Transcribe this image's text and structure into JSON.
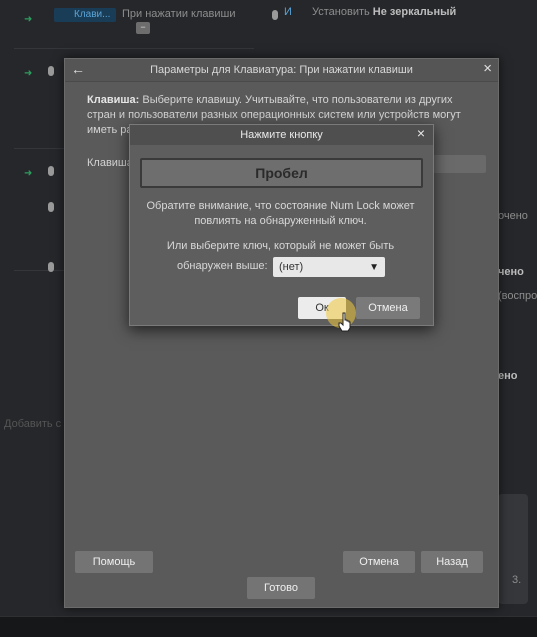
{
  "background": {
    "rows": [
      {
        "chip_label": "Клави...",
        "trigger": "При нажатии клавиши"
      },
      {
        "trigger": ""
      },
      {
        "trigger": ""
      }
    ],
    "top_right": {
      "prefix": "И",
      "action": "Установить",
      "value": "Не зеркальный",
      "sub": "..."
    },
    "right_fragments": [
      "очено",
      "чено",
      "(воспро",
      "ено"
    ],
    "footer_link": "Добавить с",
    "side_number": "3."
  },
  "dialog": {
    "title": "Параметры для Клавиатура: При нажатии клавиши",
    "back_icon": "arrow-left-icon",
    "close_icon": "close-icon",
    "desc_label": "Клавиша:",
    "desc_text": "Выберите клавишу. Учитывайте, что пользователи из других стран и пользователи разных операционных систем или устройств могут иметь разные",
    "key_label": "Клавиша",
    "buttons": {
      "help": "Помощь",
      "cancel": "Отмена",
      "back": "Назад",
      "done": "Готово"
    }
  },
  "modal": {
    "title": "Нажмите кнопку",
    "key_value": "Пробел",
    "note_numlock": "Обратите внимание, что состояние Num Lock может повлиять на обнаруженный ключ.",
    "note_choose_1": "Или выберите ключ, который не может быть",
    "note_choose_2": "обнаружен выше:",
    "select_value": "(нет)",
    "ok_label": "Ок",
    "cancel_label": "Отмена"
  }
}
